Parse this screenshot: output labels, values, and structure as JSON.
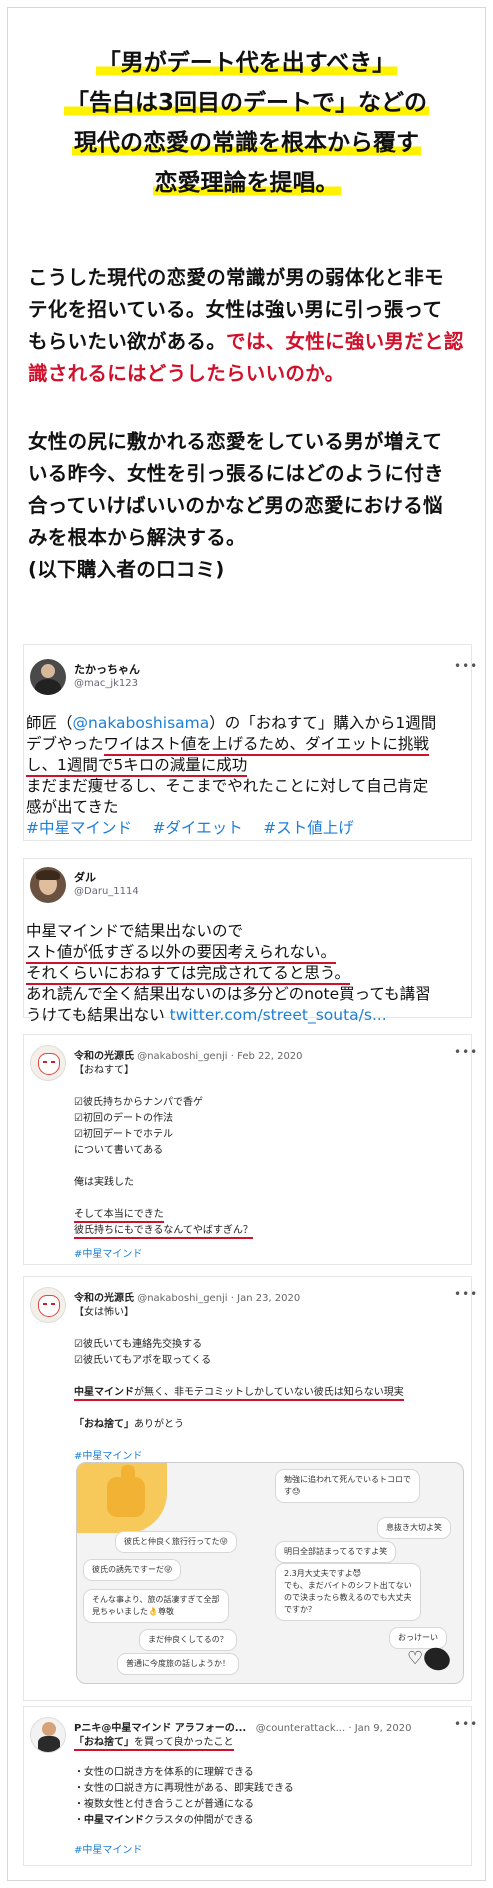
{
  "hero": {
    "lines": [
      "「男がデート代を出すべき」",
      "「告白は3回目のデートで」などの",
      "現代の恋愛の常識を根本から覆す",
      "恋愛理論を提唱。"
    ]
  },
  "intro": {
    "l1": "こうした現代の恋愛の常識が男の弱体化と非モ",
    "l2": "テ化を招いている。女性は強い男に引っ張って",
    "l3a": "もらいたい欲がある。",
    "l3b": "では、女性に強い男だと認",
    "l4": "識されるにはどうしたらいいのか。"
  },
  "body2": {
    "l1": "女性の尻に敷かれる恋愛をしている男が増えて",
    "l2": "いる昨今、女性を引っ張るにはどのように付き",
    "l3": "合っていけばいいのかなど男の恋愛における悩",
    "l4": "みを根本から解決する。",
    "l5": "(以下購入者の口コミ)"
  },
  "tweet1": {
    "name": "たかっちゃん",
    "handle": "@mac_jk123",
    "more": "•••",
    "l1a": "師匠（",
    "l1b": "@nakaboshisama",
    "l1c": "）の「おねすて」購入から1週間",
    "l2a": "デブやった",
    "l2b": "ワイはスト値を上げるため、ダイエットに挑戦",
    "l3": "し、1週間で5キロの減量に成功",
    "l4": "まだまだ痩せるし、そこまでやれたことに対して自己肯定",
    "l5": "感が出てきた",
    "tags": [
      "#中星マインド",
      "#ダイエット",
      "#スト値上げ"
    ]
  },
  "tweet2": {
    "name": "ダル",
    "handle": "@Daru_1114",
    "l1": "中星マインドで結果出ないので",
    "l2": "スト値が低すぎる以外の要因考えられない。",
    "l3": "それくらいにおねすては完成されてると思う。",
    "l4": "あれ読んで全く結果出ないのは多分どのnote買っても講習",
    "l5a": "うけても結果出ない ",
    "l5b": "twitter.com/street_souta/s..."
  },
  "tweet3": {
    "name": "令和の光源氏",
    "handle": "@nakaboshi_genji · Feb 22, 2020",
    "more": "•••",
    "lines": [
      "【おねすて】",
      "",
      "☑彼氏持ちからナンパで香ゲ",
      "☑初回のデートの作法",
      "☑初回デートでホテル",
      "について書いてある",
      "",
      "俺は実践した",
      ""
    ],
    "u1": "そして本当にできた",
    "u2": "彼氏持ちにもできるなんてやばすぎん？",
    "tag": "#中星マインド"
  },
  "tweet4": {
    "name": "令和の光源氏",
    "handle": "@nakaboshi_genji · Jan 23, 2020",
    "more": "•••",
    "lines": [
      "【女は怖い】",
      "",
      "☑彼氏いても連絡先交換する",
      "☑彼氏いてもアポを取ってくる",
      ""
    ],
    "u1a": "中星マインド",
    "u1b": "が無く、非モテコミットしかしていない彼氏は知らない現実",
    "l_last_a": "「おね捨て」",
    "l_last_b": "ありがとう",
    "tag": "#中星マインド",
    "chat": {
      "left": [
        "彼氏と仲良く旅行行ってた😜",
        "彼氏の誘先ですーだ😜",
        "そんな事より、旅の話凄すぎて全部\n見ちゃいました👌尊敬",
        "まだ仲良くしてるの？",
        "普通に今度旅の話しようか！"
      ],
      "right": [
        "勉強に追われて死んでいるトコロで\nす😓",
        "息抜き大切よ笑",
        "明日全部詰まってるですよ笑",
        "2.3月大丈夫ですよ😈\nでも、まだバイトのシフト出てない\nので決まったら教えるのでも大丈夫\nですか？",
        "おっけーい"
      ]
    }
  },
  "tweet5": {
    "name": "Pニキ@中星マインド アラフォーの...",
    "handle": "@counterattack... · Jan 9, 2020",
    "more": "•••",
    "u1a": "「おね捨て」",
    "u1b": "を買って良かったこと",
    "bullets": [
      "・女性の口説き方を体系的に理解できる",
      "・女性の口説き方に再現性がある、即実践できる",
      "・複数女性と付き合うことが普通になる"
    ],
    "last_a": "・",
    "last_b": "中星マインド",
    "last_c": "クラスタの仲間ができる",
    "tag": "#中星マインド"
  }
}
